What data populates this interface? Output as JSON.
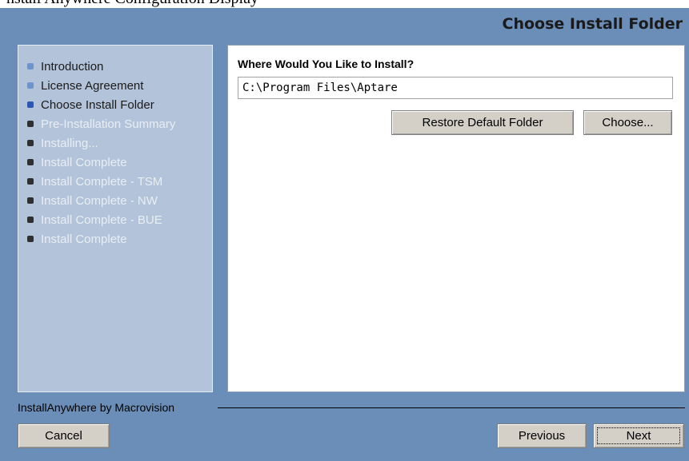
{
  "top_strip": {
    "partial_text": "nstall Anywhere Configuration Display"
  },
  "header": {
    "title": "Choose Install Folder"
  },
  "steps": [
    {
      "label": "Introduction",
      "state": "done"
    },
    {
      "label": "License Agreement",
      "state": "done"
    },
    {
      "label": "Choose Install Folder",
      "state": "current"
    },
    {
      "label": "Pre-Installation Summary",
      "state": "pending"
    },
    {
      "label": "Installing...",
      "state": "pending"
    },
    {
      "label": "Install Complete",
      "state": "pending"
    },
    {
      "label": "Install Complete - TSM",
      "state": "pending"
    },
    {
      "label": "Install Complete - NW",
      "state": "pending"
    },
    {
      "label": "Install Complete - BUE",
      "state": "pending"
    },
    {
      "label": "Install Complete",
      "state": "pending"
    }
  ],
  "main": {
    "prompt": "Where Would You Like to Install?",
    "install_path": "C:\\Program Files\\Aptare",
    "restore_button": "Restore Default Folder",
    "choose_button": "Choose..."
  },
  "footer": {
    "vendor": "InstallAnywhere by Macrovision",
    "cancel": "Cancel",
    "previous": "Previous",
    "next": "Next"
  },
  "colors": {
    "frame_bg": "#6b8eb8",
    "left_panel_bg": "#b3c3d9",
    "bullet_done": "#6f93cc",
    "bullet_current": "#2a57b5",
    "bullet_pending": "#2f2f2f",
    "button_face": "#d4d0c8"
  }
}
